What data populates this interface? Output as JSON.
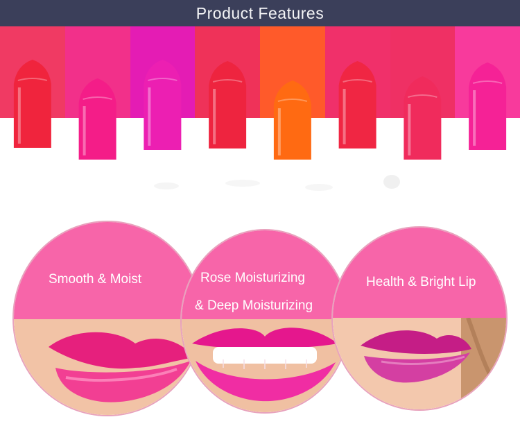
{
  "header": {
    "title": "Product Features"
  },
  "colors": {
    "header_bg": "#3b3f5a",
    "bubble_pink": "#f765a9",
    "bubble_border": "#e8a2bd",
    "swatches": [
      "#f03a63",
      "#f2308a",
      "#e41cb4",
      "#ef3259",
      "#ff5a2a",
      "#f0306a",
      "#ef3064",
      "#f83a9c"
    ],
    "lipsticks": [
      "#f0243d",
      "#f41d88",
      "#ec1fb2",
      "#ee243f",
      "#ff6a12",
      "#f02643",
      "#f02b5c",
      "#f52296"
    ]
  },
  "features": [
    {
      "line1": "Smooth & Moist",
      "line2": ""
    },
    {
      "line1": "Rose Moisturizing",
      "line2": "& Deep Moisturizing"
    },
    {
      "line1": "Health & Bright Lip",
      "line2": ""
    }
  ]
}
